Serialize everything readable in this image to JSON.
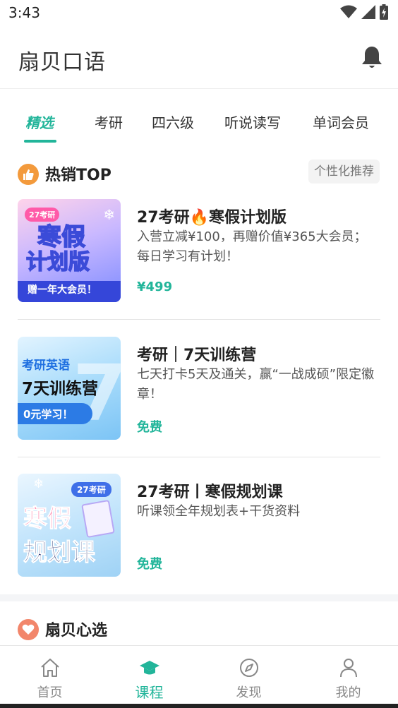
{
  "status_bar": {
    "time": "3:43"
  },
  "header": {
    "title": "扇贝口语"
  },
  "tabs": [
    {
      "label": "精选"
    },
    {
      "label": "考研"
    },
    {
      "label": "四六级"
    },
    {
      "label": "听说读写"
    },
    {
      "label": "单词会员"
    }
  ],
  "hot_section": {
    "title": "热销TOP",
    "tag": "个性化推荐"
  },
  "courses": [
    {
      "title": "27考研🔥寒假计划版",
      "desc": "入营立减¥100，再赠价值¥365大会员； 每日学习有计划！",
      "price": "¥499",
      "thumb": {
        "badge": "27考研",
        "line1": "寒假",
        "line2": "计划版",
        "banner": "赠一年大会员！"
      }
    },
    {
      "title": "考研｜7天训练营",
      "desc": "七天打卡5天及通关，赢“一战成硕”限定徽章！",
      "price": "免费",
      "thumb": {
        "line1": "考研英语",
        "line2": "7天训练营",
        "banner": "0元学习！"
      }
    },
    {
      "title": "27考研丨寒假规划课",
      "desc": "听课领全年规划表+干货资料",
      "price": "免费",
      "thumb": {
        "badge": "27考研",
        "line1": "寒假",
        "line2": "规划课"
      }
    }
  ],
  "second_section": {
    "title": "扇贝心选"
  },
  "bottom_nav": [
    {
      "label": "首页"
    },
    {
      "label": "课程"
    },
    {
      "label": "发现"
    },
    {
      "label": "我的"
    }
  ],
  "colors": {
    "accent": "#22b59a",
    "hot_icon": "#f39a3c",
    "heart_icon": "#f2866b"
  }
}
